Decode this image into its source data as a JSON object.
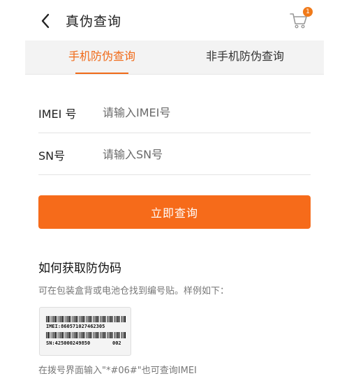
{
  "header": {
    "title": "真伪查询",
    "cart_badge": "1"
  },
  "tabs": [
    {
      "label": "手机防伪查询",
      "active": true
    },
    {
      "label": "非手机防伪查询",
      "active": false
    }
  ],
  "form": {
    "imei": {
      "label": "IMEI 号",
      "placeholder": "请输入IMEI号",
      "value": ""
    },
    "sn": {
      "label": "SN号",
      "placeholder": "请输入SN号",
      "value": ""
    }
  },
  "submit_label": "立即查询",
  "help": {
    "title": "如何获取防伪码",
    "description": "可在包装盒背或电池仓找到编号贴。样例如下：",
    "sticker": {
      "imei_text": "IMEI:860571027462305",
      "sn_text": "SN:425000249850",
      "code": "002"
    },
    "bottom_text": "在拨号界面输入\"*#06#\"也可查询IMEI"
  },
  "colors": {
    "accent": "#f66b1a",
    "tab_active": "#f06a18",
    "tab_bar_bg": "#f3f3f3"
  },
  "icons": {
    "back": "chevron-left-icon",
    "cart": "shopping-cart-icon"
  }
}
